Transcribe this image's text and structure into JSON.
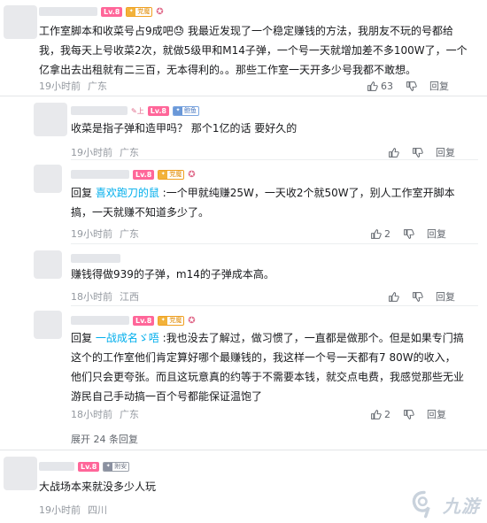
{
  "comments": [
    {
      "level": "Lv.8",
      "medal": "党魔",
      "text": "工作室脚本和收菜号占9成吧😓 我最近发现了一个稳定赚钱的方法，我朋友不玩的号都给我，我每天上号收菜2次，就做5级甲和M14子弹，一个号一天就增加差不多100W了，一个亿拿出去出租就有二三百，无本得利的。。那些工作室一天开多少号我都不敢想。",
      "time": "19小时前",
      "location": "广东",
      "likes": "63",
      "reply_label": "回复"
    },
    {
      "level": "Lv.8",
      "medal": "鲍鱼",
      "text": "收菜是指子弹和造甲吗？ 那个1亿的话 要好久的",
      "time": "19小时前",
      "location": "广东",
      "reply_label": "回复"
    },
    {
      "level": "Lv.8",
      "medal": "党魔",
      "reply_prefix": "回复 ",
      "reply_at": "喜欢跑刀的鼠",
      "text": " :一个甲就纯赚25W，一天收2个就50W了，别人工作室开脚本搞，一天就赚不知道多少了。",
      "time": "19小时前",
      "location": "广东",
      "likes": "2",
      "reply_label": "回复"
    },
    {
      "text": "赚钱得做939的子弹，m14的子弹成本高。",
      "time": "18小时前",
      "location": "江西",
      "reply_label": "回复"
    },
    {
      "level": "Lv.8",
      "medal": "党魔",
      "reply_prefix": "回复 ",
      "reply_at": "一战成名ゞ唔",
      "text": " :我也没去了解过，做习惯了，一直都是做那个。但是如果专门搞这个的工作室他们肯定算好哪个最赚钱的，我这样一个号一天都有7 80W的收入，他们只会更夸张。而且这玩意真的约等于不需要本钱，就交点电费，我感觉那些无业游民自己手动搞一百个号都能保证温饱了",
      "time": "18小时前",
      "location": "广东",
      "likes": "2",
      "reply_label": "回复"
    }
  ],
  "expand_label": "展开 24 条回复",
  "last_comment": {
    "level": "Lv.8",
    "medal": "附安",
    "text": "大战场本来就没多少人玩",
    "time": "19小时前",
    "location": "四川"
  },
  "watermark": {
    "text": "九游"
  }
}
